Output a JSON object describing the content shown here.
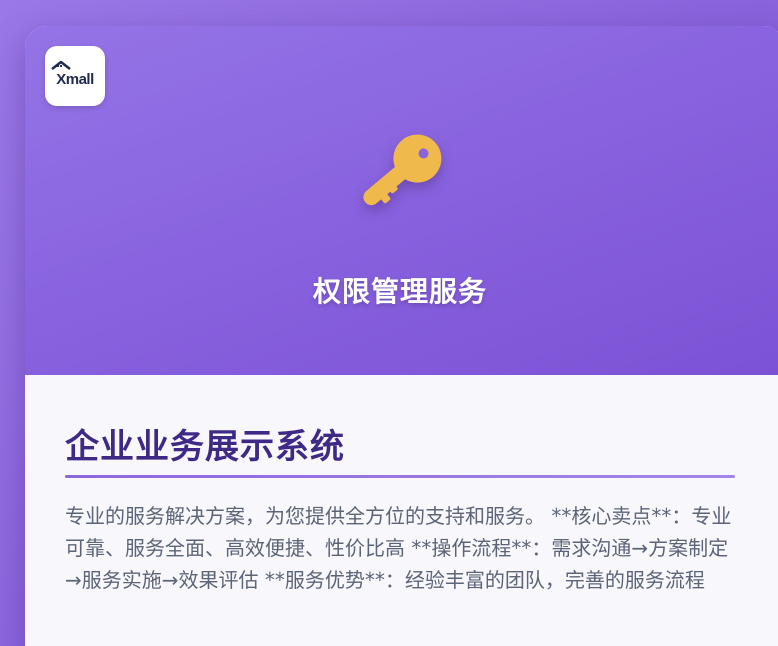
{
  "brand": {
    "logo_text": "Xmall",
    "logo_icon": "house-roof-icon"
  },
  "hero": {
    "icon": "key-icon",
    "icon_color": "#efb94b",
    "title": "权限管理服务",
    "background": "#8a64dc"
  },
  "content": {
    "section_title": "企业业务展示系统",
    "description": "专业的服务解决方案，为您提供全方位的支持和服务。 **核心卖点**：专业可靠、服务全面、高效便捷、性价比高 **操作流程**：需求沟通→方案制定→服务实施→效果评估 **服务优势**：经验丰富的团队，完善的服务流程"
  },
  "colors": {
    "accent": "#8a64dc",
    "title": "#3e2a86",
    "text": "#5c6478"
  }
}
